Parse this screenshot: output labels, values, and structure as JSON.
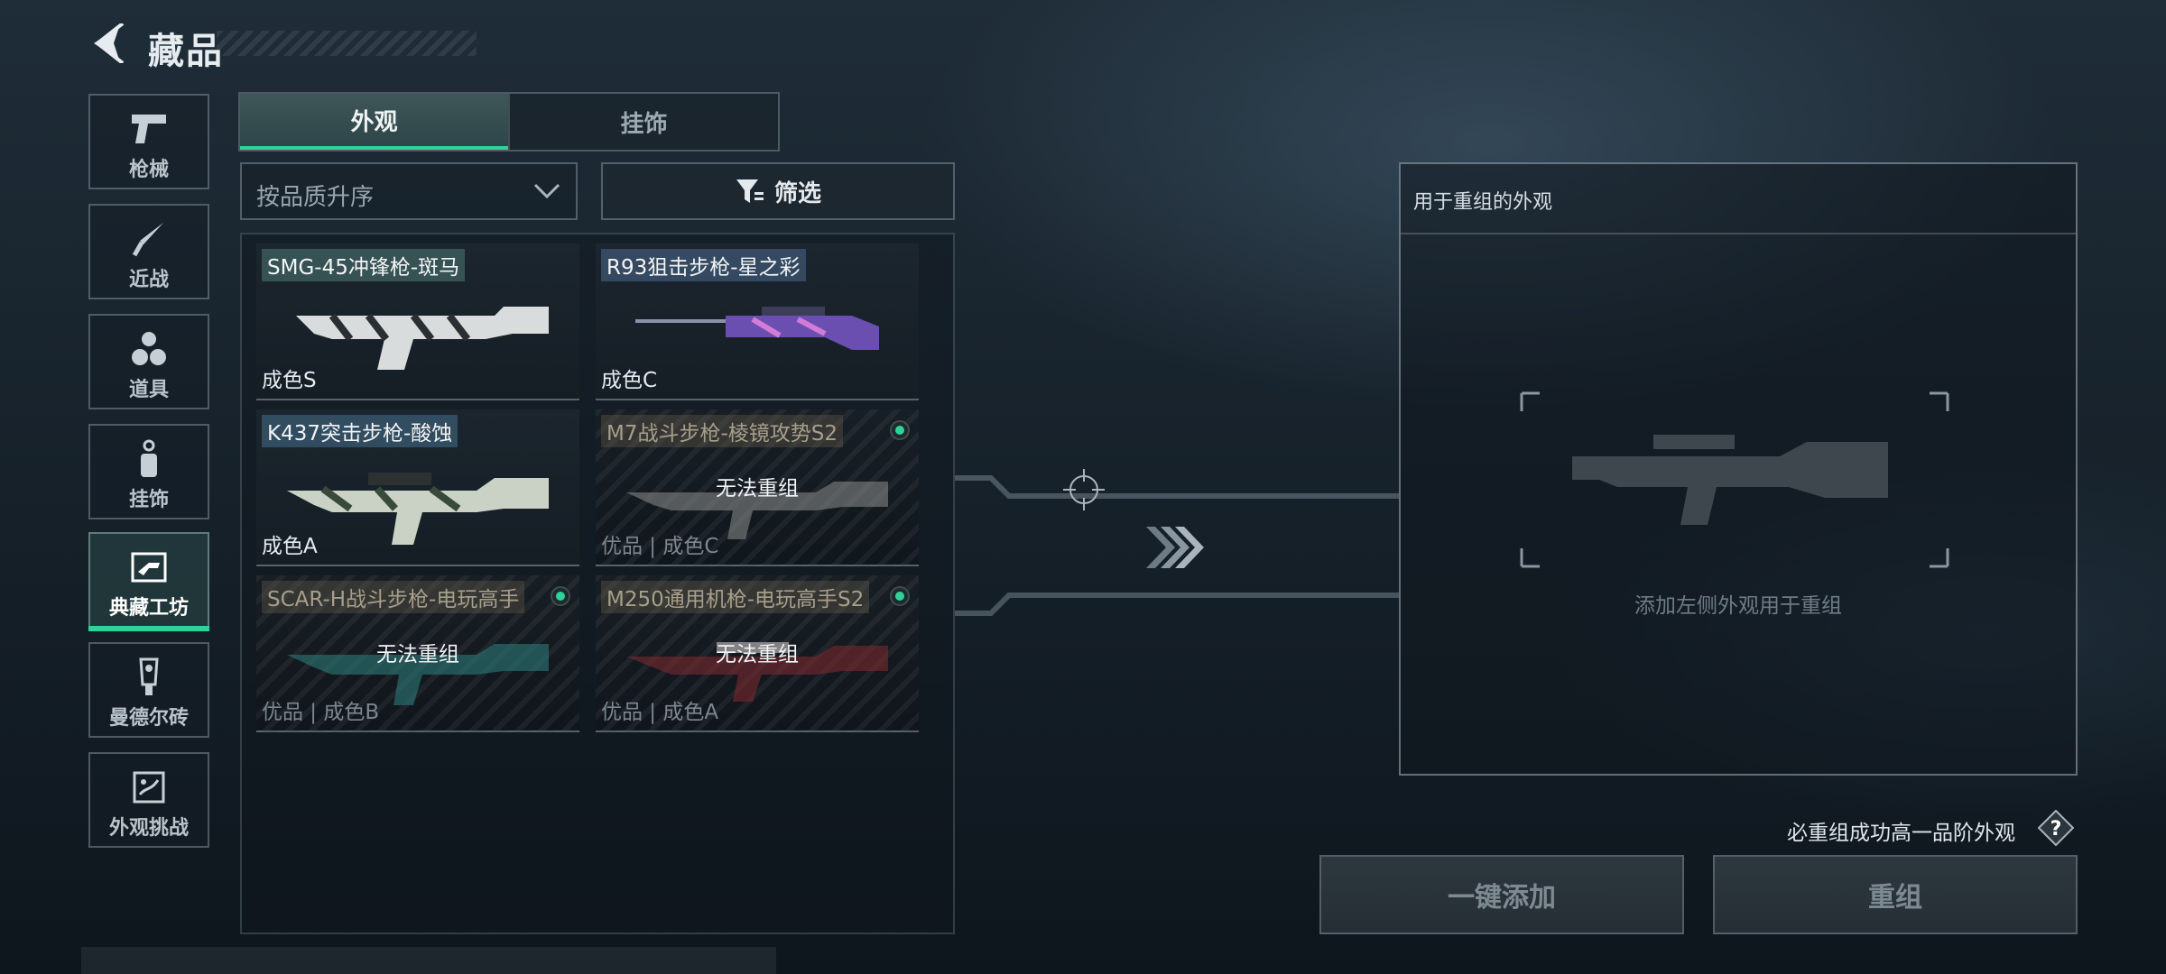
{
  "header": {
    "title": "藏品"
  },
  "nav": [
    {
      "label": "枪械",
      "icon": "pistol-icon"
    },
    {
      "label": "近战",
      "icon": "knife-icon"
    },
    {
      "label": "道具",
      "icon": "grenades-icon"
    },
    {
      "label": "挂饰",
      "icon": "charm-icon"
    },
    {
      "label": "典藏工坊",
      "icon": "workshop-icon",
      "active": true
    },
    {
      "label": "曼德尔砖",
      "icon": "mandel-brick-icon"
    },
    {
      "label": "外观挑战",
      "icon": "challenge-icon"
    }
  ],
  "tabs": [
    {
      "label": "外观",
      "active": true
    },
    {
      "label": "挂饰",
      "active": false
    }
  ],
  "sort": {
    "label": "按品质升序"
  },
  "filter": {
    "label": "筛选"
  },
  "cards": [
    {
      "name": "SMG-45冲锋枪-斑马",
      "grade": "成色S",
      "locked": false
    },
    {
      "name": "R93狙击步枪-星之彩",
      "grade": "成色C",
      "locked": false
    },
    {
      "name": "K437突击步枪-酸蚀",
      "grade": "成色A",
      "locked": false
    },
    {
      "name": "M7战斗步枪-棱镜攻势S2",
      "grade": "优品 | 成色C",
      "locked": true,
      "lock_text": "无法重组"
    },
    {
      "name": "SCAR-H战斗步枪-电玩高手",
      "grade": "优品 | 成色B",
      "locked": true,
      "lock_text": "无法重组"
    },
    {
      "name": "M250通用机枪-电玩高手S2",
      "grade": "优品 | 成色A",
      "locked": true,
      "lock_text": "无法重组"
    }
  ],
  "recombine": {
    "header": "用于重组的外观",
    "hint": "添加左侧外观用于重组"
  },
  "guarantee": {
    "text": "必重组成功高一品阶外观"
  },
  "buttons": {
    "add_all": "一键添加",
    "recombine": "重组"
  },
  "colors": {
    "accent": "#2fd39a",
    "bg": "#17222b"
  }
}
